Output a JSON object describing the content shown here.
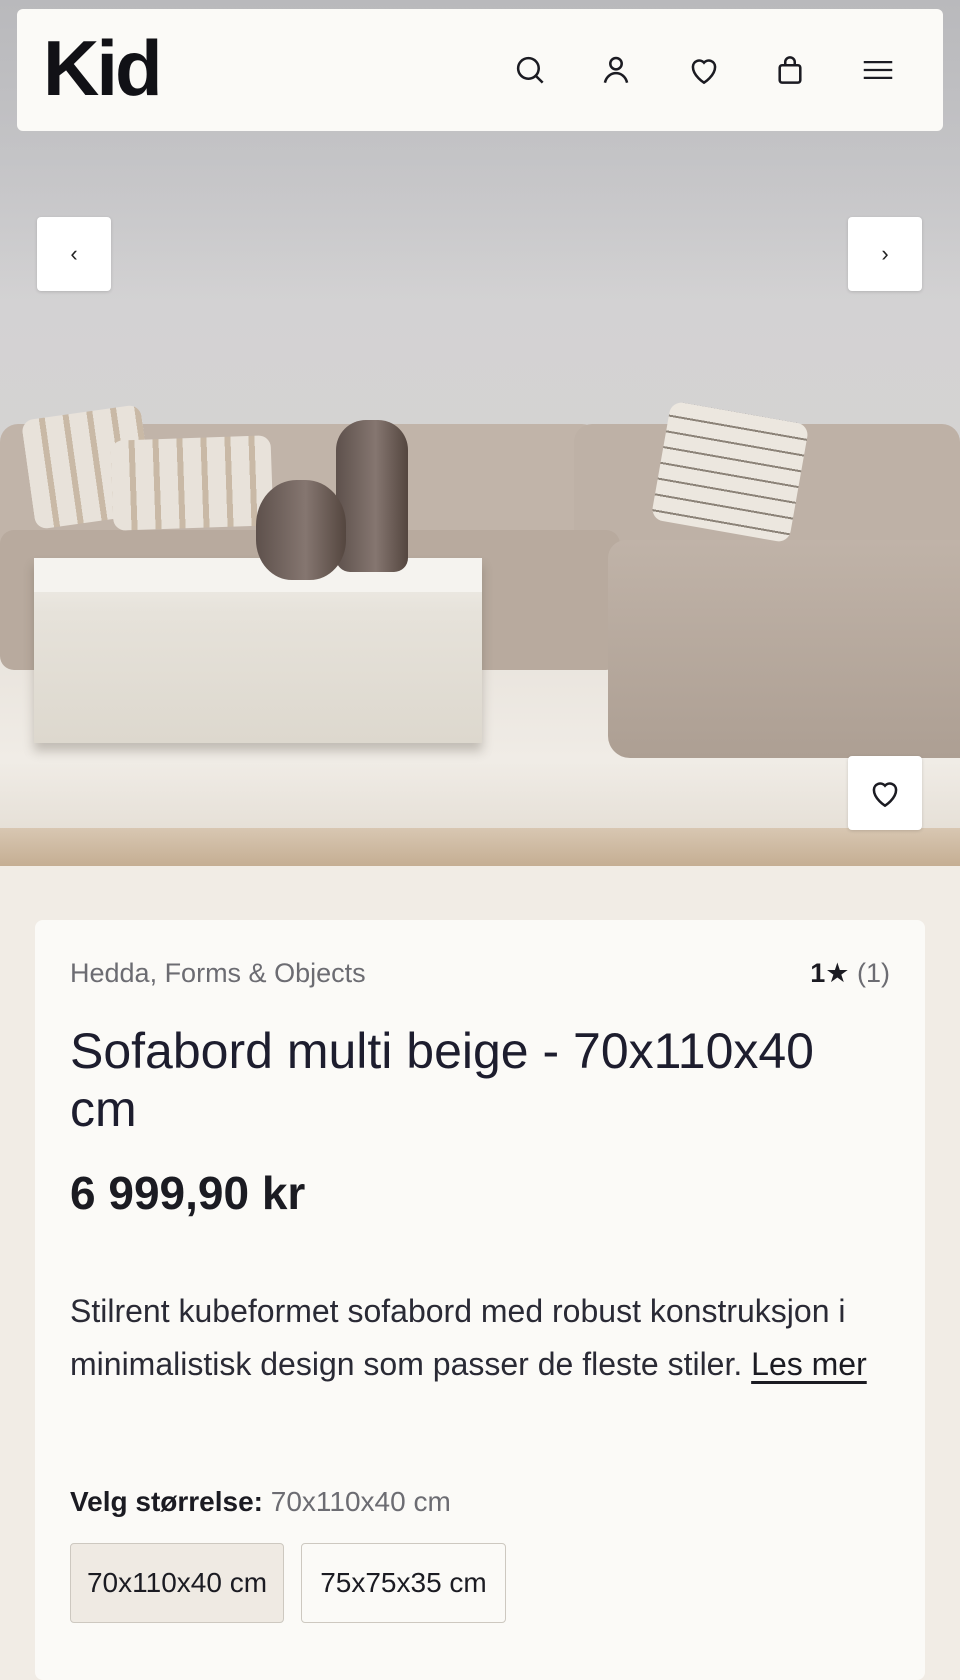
{
  "header": {
    "logo": "Kid",
    "icons": [
      "search-icon",
      "user-icon",
      "heart-icon",
      "bag-icon",
      "menu-icon"
    ]
  },
  "gallery": {
    "prev_label": "‹",
    "next_label": "›"
  },
  "product": {
    "brand": "Hedda, Forms & Objects",
    "rating_value": "1",
    "rating_star": "★",
    "rating_count": "(1)",
    "title": "Sofabord multi beige - 70x110x40 cm",
    "price": "6 999,90 kr",
    "description": "Stilrent kubeformet sofabord med robust konstruksjon i minimalistisk design som passer de fleste stiler.",
    "read_more": "Les mer",
    "size_label": "Velg størrelse:",
    "size_selected": "70x110x40 cm",
    "size_options": [
      "70x110x40 cm",
      "75x75x35 cm"
    ]
  },
  "colors": {
    "background": "#f1ece5",
    "card": "#fbfaf7",
    "text": "#1b1b22",
    "muted": "#6c6c72"
  }
}
